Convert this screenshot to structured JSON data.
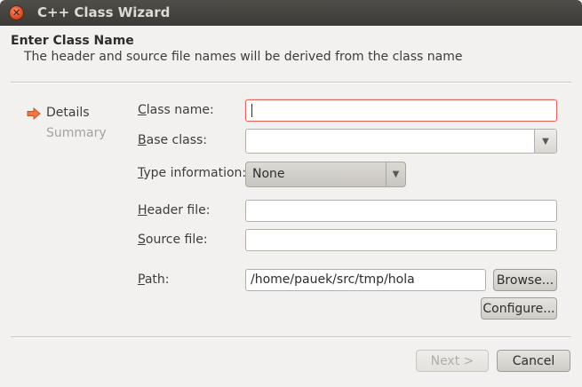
{
  "window": {
    "title": "C++ Class Wizard"
  },
  "header": {
    "heading": "Enter Class Name",
    "description": "The header and source file names will be derived from the class name"
  },
  "steps": [
    {
      "label": "Details",
      "active": true
    },
    {
      "label": "Summary",
      "active": false
    }
  ],
  "form": {
    "class_name": {
      "label_accel": "C",
      "label_rest": "lass name:",
      "value": ""
    },
    "base_class": {
      "label_accel": "B",
      "label_rest": "ase class:",
      "value": ""
    },
    "type_information": {
      "label_accel": "T",
      "label_rest": "ype information:",
      "value": "None"
    },
    "header_file": {
      "label_accel": "H",
      "label_rest": "eader file:",
      "value": ""
    },
    "source_file": {
      "label_accel": "S",
      "label_rest": "ource file:",
      "value": ""
    },
    "path": {
      "label_accel": "P",
      "label_rest": "ath:",
      "value": "/home/pauek/src/tmp/hola"
    }
  },
  "buttons": {
    "browse": "Browse...",
    "configure": "Configure...",
    "next": "Next >",
    "cancel": "Cancel"
  },
  "colors": {
    "titlebar": "#3b3a36",
    "accent_arrow": "#f07746",
    "focus_border": "#e0685a"
  },
  "icons": {
    "close": "close-icon",
    "step_arrow": "arrow-right-icon",
    "combo_dropdown": "chevron-down-icon"
  }
}
